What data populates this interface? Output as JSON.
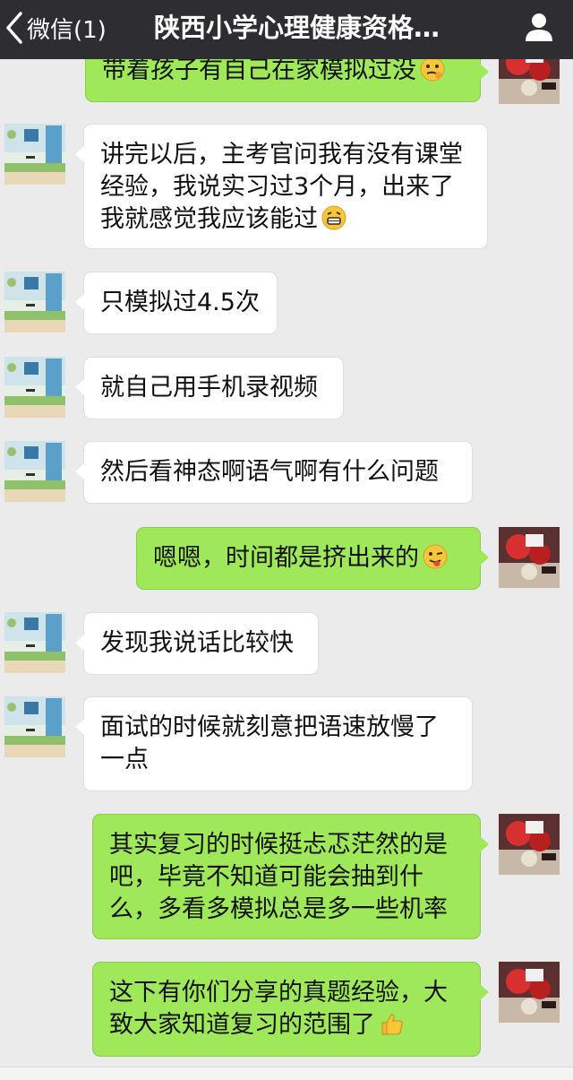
{
  "header": {
    "back_label": "微信(1)",
    "title": "陕西小学心理健康资格…"
  },
  "messages": [
    {
      "side": "out",
      "text": "带着孩子有自己在家模拟过没",
      "emoji": "awkward-face-icon"
    },
    {
      "side": "in",
      "text": "讲完以后，主考官问我有没有课堂经验，我说实习过3个月，出来了我就感觉我应该能过",
      "emoji": "grin-face-icon"
    },
    {
      "side": "in",
      "text": "只模拟过4.5次"
    },
    {
      "side": "in",
      "text": "就自己用手机录视频"
    },
    {
      "side": "in",
      "text": "然后看神态啊语气啊有什么问题"
    },
    {
      "side": "out",
      "text": "嗯嗯，时间都是挤出来的",
      "emoji": "wink-tongue-face-icon"
    },
    {
      "side": "in",
      "text": "发现我说话比较快"
    },
    {
      "side": "in",
      "text": "面试的时候就刻意把语速放慢了一点"
    },
    {
      "side": "out",
      "text": "其实复习的时候挺忐忑茫然的是吧，毕竟不知道可能会抽到什么，多看多模拟总是多一些机率"
    },
    {
      "side": "out",
      "text": "这下有你们分享的真题经验，大致大家知道复习的范围了",
      "emoji": "thumbs-up-icon"
    }
  ],
  "colors": {
    "nav_bg": "#2e2e32",
    "chat_bg": "#ebebeb",
    "incoming_bubble": "#ffffff",
    "outgoing_bubble": "#9ee85a"
  }
}
